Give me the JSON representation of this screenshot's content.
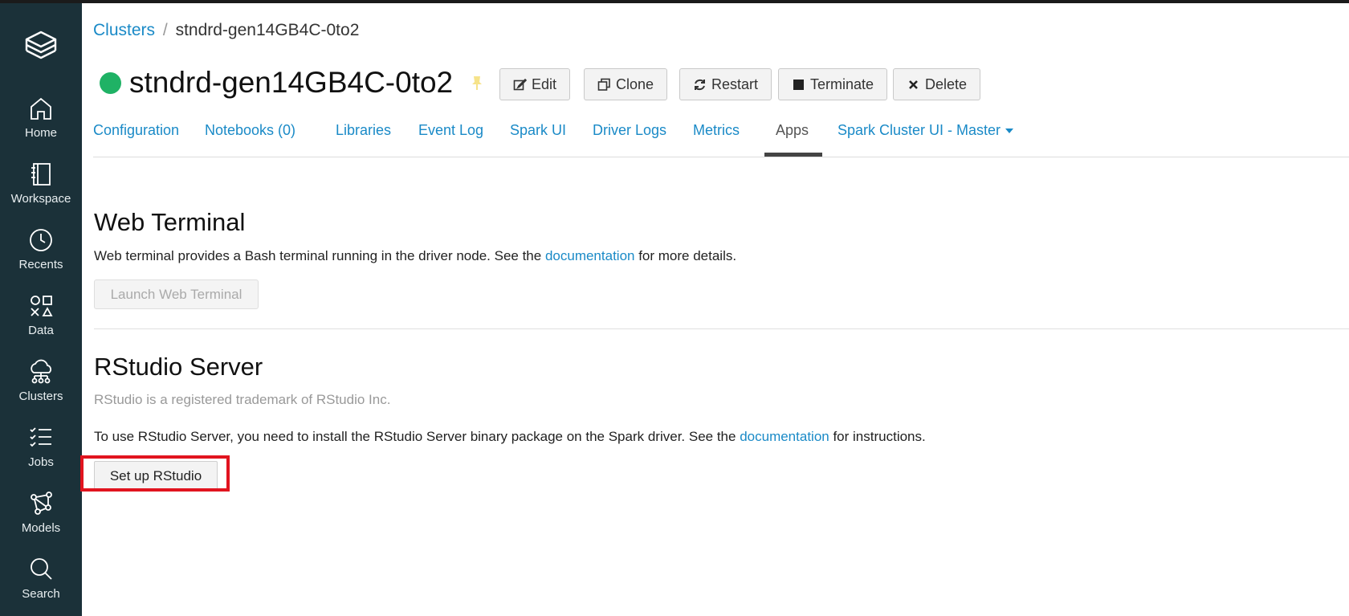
{
  "sidebar": {
    "items": [
      {
        "label": "Home",
        "icon": "home-icon"
      },
      {
        "label": "Workspace",
        "icon": "workspace-icon"
      },
      {
        "label": "Recents",
        "icon": "clock-icon"
      },
      {
        "label": "Data",
        "icon": "data-icon"
      },
      {
        "label": "Clusters",
        "icon": "cloud-icon"
      },
      {
        "label": "Jobs",
        "icon": "jobs-icon"
      },
      {
        "label": "Models",
        "icon": "models-icon"
      },
      {
        "label": "Search",
        "icon": "search-icon"
      }
    ]
  },
  "breadcrumb": {
    "root": "Clusters",
    "separator": "/",
    "current": "stndrd-gen14GB4C-0to2"
  },
  "header": {
    "cluster_name": "stndrd-gen14GB4C-0to2",
    "status_color": "#1fb265",
    "buttons": {
      "edit": "Edit",
      "clone": "Clone",
      "restart": "Restart",
      "terminate": "Terminate",
      "delete": "Delete"
    }
  },
  "tabs": [
    {
      "label": "Configuration"
    },
    {
      "label": "Notebooks (0)"
    },
    {
      "label": "Libraries"
    },
    {
      "label": "Event Log"
    },
    {
      "label": "Spark UI"
    },
    {
      "label": "Driver Logs"
    },
    {
      "label": "Metrics"
    },
    {
      "label": "Apps",
      "active": true
    },
    {
      "label": "Spark Cluster UI - Master"
    }
  ],
  "web_terminal": {
    "title": "Web Terminal",
    "text_before": "Web terminal provides a Bash terminal running in the driver node. See the ",
    "link": "documentation",
    "text_after": " for more details.",
    "button": "Launch Web Terminal"
  },
  "rstudio": {
    "title": "RStudio Server",
    "trademark": "RStudio is a registered trademark of RStudio Inc.",
    "text_before": "To use RStudio Server, you need to install the RStudio Server binary package on the Spark driver. See the ",
    "link": "documentation",
    "text_after": " for instructions.",
    "button": "Set up RStudio"
  },
  "colors": {
    "sidebar": "#1b3139",
    "link": "#1a8ac7",
    "highlight": "#e1141f"
  }
}
